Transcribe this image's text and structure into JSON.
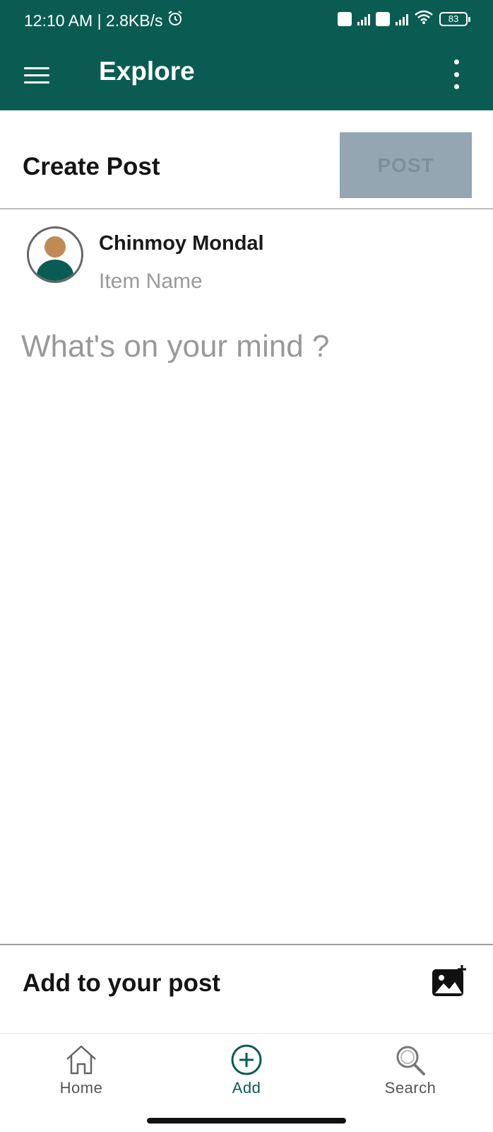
{
  "status_bar": {
    "time_speed": "12:10 AM | 2.8KB/s",
    "battery": "83",
    "icons": [
      "alarm-icon",
      "volte-icon",
      "signal-icon",
      "wifi-icon",
      "battery-icon"
    ]
  },
  "toolbar": {
    "title": "Explore",
    "menu_icon": "hamburger-menu-icon",
    "more_icon": "more-vert-icon"
  },
  "create_post": {
    "title": "Create Post",
    "post_button": "POST"
  },
  "user": {
    "name": "Chinmoy Mondal",
    "item_name": "Item Name"
  },
  "composer": {
    "placeholder": "What's on your mind ?"
  },
  "add_section": {
    "title": "Add to your post",
    "icon": "add-photo-icon"
  },
  "bottom_nav": {
    "items": [
      {
        "label": "Home",
        "icon": "home-icon"
      },
      {
        "label": "Add",
        "icon": "add-circle-icon",
        "active": true
      },
      {
        "label": "Search",
        "icon": "search-icon"
      }
    ]
  },
  "colors": {
    "primary": "#0a5c52",
    "post_button_bg": "#93a6b1",
    "active_nav": "#0a5c52",
    "inactive_nav": "#555555"
  }
}
